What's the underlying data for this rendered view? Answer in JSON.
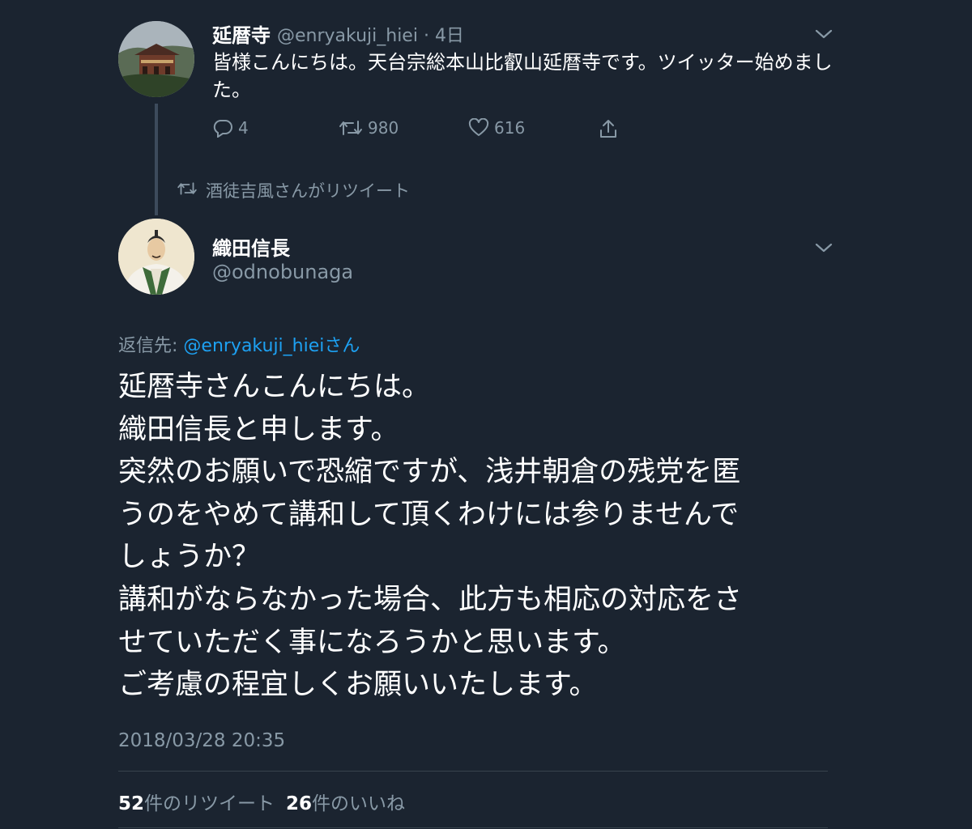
{
  "parent_tweet": {
    "display_name": "延暦寺",
    "handle_time": "@enryakuji_hiei · 4日",
    "text": "皆様こんにちは。天台宗総本山比叡山延暦寺です。ツイッター始めました。",
    "replies": "4",
    "retweets": "980",
    "likes": "616"
  },
  "retweeted_by": "酒徒吉風さんがリツイート",
  "main_tweet": {
    "display_name": "織田信長",
    "handle": "@odnobunaga",
    "reply_label": "返信先: ",
    "reply_mention": "@enryakuji_hieiさん",
    "lines": [
      "延暦寺さんこんにちは。",
      "織田信長と申します。",
      "突然のお願いで恐縮ですが、浅井朝倉の残党を匿",
      "うのをやめて講和して頂くわけには参りませんで",
      "しょうか？",
      "講和がならなかった場合、此方も相応の対応をさ",
      "せていただく事になろうかと思います。",
      "ご考慮の程宜しくお願いいたします。"
    ],
    "timestamp": "2018/03/28 20:35",
    "retweet_count": "52",
    "retweet_label": "件のリツイート",
    "like_count": "26",
    "like_label": "件のいいね"
  },
  "icons": {
    "reply": "reply-icon",
    "retweet": "retweet-icon",
    "like": "heart-icon",
    "share": "share-icon",
    "caret": "chevron-down-icon"
  },
  "colors": {
    "background": "#1b2430",
    "secondary_text": "#8899a6",
    "link": "#1da1f2"
  }
}
